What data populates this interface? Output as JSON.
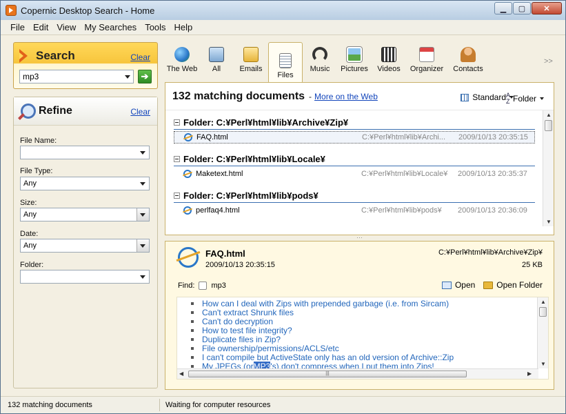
{
  "window": {
    "title": "Copernic Desktop Search - Home"
  },
  "menu": [
    "File",
    "Edit",
    "View",
    "My Searches",
    "Tools",
    "Help"
  ],
  "search": {
    "title": "Search",
    "clear": "Clear",
    "query": "mp3"
  },
  "refine": {
    "title": "Refine",
    "clear": "Clear",
    "fields": [
      {
        "label": "File Name:",
        "value": ""
      },
      {
        "label": "File Type:",
        "value": "Any"
      },
      {
        "label": "Size:",
        "value": "Any"
      },
      {
        "label": "Date:",
        "value": "Any"
      },
      {
        "label": "Folder:",
        "value": ""
      }
    ]
  },
  "categories": [
    {
      "label": "The Web",
      "icon": "globe-icon"
    },
    {
      "label": "All",
      "icon": "computer-icon"
    },
    {
      "label": "Emails",
      "icon": "envelope-icon"
    },
    {
      "label": "Files",
      "icon": "document-icon"
    },
    {
      "label": "Music",
      "icon": "headphones-icon"
    },
    {
      "label": "Pictures",
      "icon": "picture-icon"
    },
    {
      "label": "Videos",
      "icon": "film-icon"
    },
    {
      "label": "Organizer",
      "icon": "calendar-icon"
    },
    {
      "label": "Contacts",
      "icon": "contact-icon"
    }
  ],
  "more_label": ">>",
  "results": {
    "count": "132 matching documents",
    "dash": "-",
    "more_web": "More on the Web",
    "view": "Standard",
    "sort": "Folder",
    "groups": [
      {
        "folder": "Folder: C:¥Perl¥html¥lib¥Archive¥Zip¥",
        "file": "FAQ.html",
        "path": "C:¥Perl¥html¥lib¥Archi...",
        "date": "2009/10/13 20:35:15"
      },
      {
        "folder": "Folder: C:¥Perl¥html¥lib¥Locale¥",
        "file": "Maketext.html",
        "path": "C:¥Perl¥html¥lib¥Locale¥",
        "date": "2009/10/13 20:35:37"
      },
      {
        "folder": "Folder: C:¥Perl¥html¥lib¥pods¥",
        "file": "perlfaq4.html",
        "path": "C:¥Perl¥html¥lib¥pods¥",
        "date": "2009/10/13 20:36:09"
      }
    ]
  },
  "preview": {
    "name": "FAQ.html",
    "date": "2009/10/13 20:35:15",
    "path": "C:¥Perl¥html¥lib¥Archive¥Zip¥",
    "size": "25 KB",
    "find_label": "Find:",
    "find_term": "mp3",
    "open": "Open",
    "open_folder": "Open Folder",
    "lines": [
      "How can I deal with Zips with prepended garbage (i.e. from Sircam)",
      "Can't extract Shrunk files",
      "Can't do decryption",
      "How to test file integrity?",
      "Duplicate files in Zip?",
      "File ownership/permissions/ACLS/etc",
      "I can't compile but ActiveState only has an old version of Archive::Zip"
    ],
    "last_line": {
      "before": "My JPEGs (or ",
      "highlight": "MP3",
      "after": "'s) don't compress when I put them into Zips!"
    }
  },
  "status": {
    "left": "132 matching documents",
    "right": "Waiting for computer resources"
  }
}
